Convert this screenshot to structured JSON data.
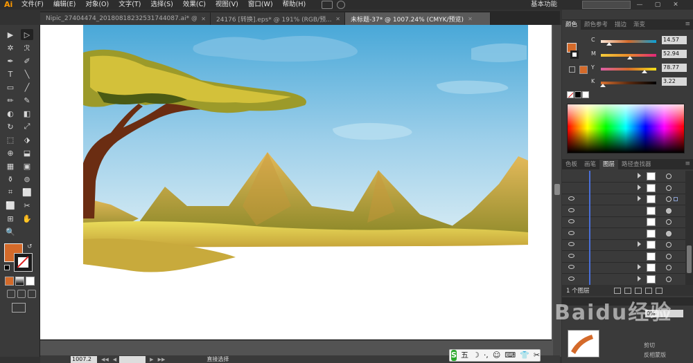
{
  "app": {
    "logo": "Ai",
    "menus": [
      "文件(F)",
      "编辑(E)",
      "对象(O)",
      "文字(T)",
      "选择(S)",
      "效果(C)",
      "视图(V)",
      "窗口(W)",
      "帮助(H)"
    ],
    "workspace": "基本功能",
    "search_placeholder": ""
  },
  "tabs": [
    {
      "label": "Nipic_27404474_20180818232531744087.ai* @ 150% (CMYK/...",
      "active": false
    },
    {
      "label": "24176 [转换].eps* @ 191% (RGB/预...",
      "active": false
    },
    {
      "label": "未标题-37* @ 1007.24% (CMYK/预览)",
      "active": true
    }
  ],
  "toolbar": {
    "tools": [
      "▶",
      "▷",
      "✲",
      "ℛ",
      "✒",
      "✐",
      "T",
      "╲",
      "▭",
      "╱",
      "✏",
      "✎",
      "◐",
      "◧",
      "↻",
      "⤢",
      "⬚",
      "⬗",
      "⊕",
      "⬓",
      "▦",
      "▣",
      "⚱",
      "⊚",
      "⌗",
      "⬜",
      "⬜",
      "✂",
      "⊞",
      "✋",
      "🔍",
      ""
    ]
  },
  "color_panel": {
    "tabs": [
      "颜色",
      "颜色参考",
      "描边",
      "渐变"
    ],
    "sliders": [
      {
        "letter": "C",
        "value": "14.57",
        "fraction": 0.1457,
        "gradient": "linear-gradient(to right,#fbe7d6,#d46a2a,#0aa0d6)"
      },
      {
        "letter": "M",
        "value": "52.94",
        "fraction": 0.5294,
        "gradient": "linear-gradient(to right,#f4cc3a,#e88a2a,#e2257a)"
      },
      {
        "letter": "Y",
        "value": "78.77",
        "fraction": 0.7877,
        "gradient": "linear-gradient(to right,#dc5fa6,#d46a2a,#f3e01a)"
      },
      {
        "letter": "K",
        "value": "3.22",
        "fraction": 0.0322,
        "gradient": "linear-gradient(to right,#d87030,#5a2a10,#000000)"
      }
    ],
    "fill_color": "#d46a2a"
  },
  "layers_panel": {
    "tabs": [
      "色板",
      "画笔",
      "图层",
      "路径查找器"
    ],
    "count_label": "1 个图层",
    "rows": [
      {
        "visible": false,
        "has_arrow": true,
        "target_filled": false
      },
      {
        "visible": false,
        "has_arrow": true,
        "target_filled": false
      },
      {
        "visible": true,
        "has_arrow": true,
        "target_filled": false
      },
      {
        "visible": true,
        "has_arrow": false,
        "target_filled": true
      },
      {
        "visible": true,
        "has_arrow": false,
        "target_filled": false
      },
      {
        "visible": true,
        "has_arrow": false,
        "target_filled": true
      },
      {
        "visible": true,
        "has_arrow": true,
        "target_filled": false
      },
      {
        "visible": true,
        "has_arrow": false,
        "target_filled": false
      },
      {
        "visible": true,
        "has_arrow": true,
        "target_filled": false
      },
      {
        "visible": true,
        "has_arrow": true,
        "target_filled": false
      }
    ]
  },
  "mini_panel": {
    "percent": "0%",
    "options": [
      "剪切",
      "反相蒙版"
    ]
  },
  "statusbar": {
    "zoom": "1007.2",
    "tool_name": "直接选择"
  },
  "ime": {
    "logo": "S",
    "mode": "五",
    "items": [
      "☽",
      "·,",
      "☺",
      "⌨",
      "👕",
      "✂"
    ]
  },
  "watermark": "Baidu经验"
}
